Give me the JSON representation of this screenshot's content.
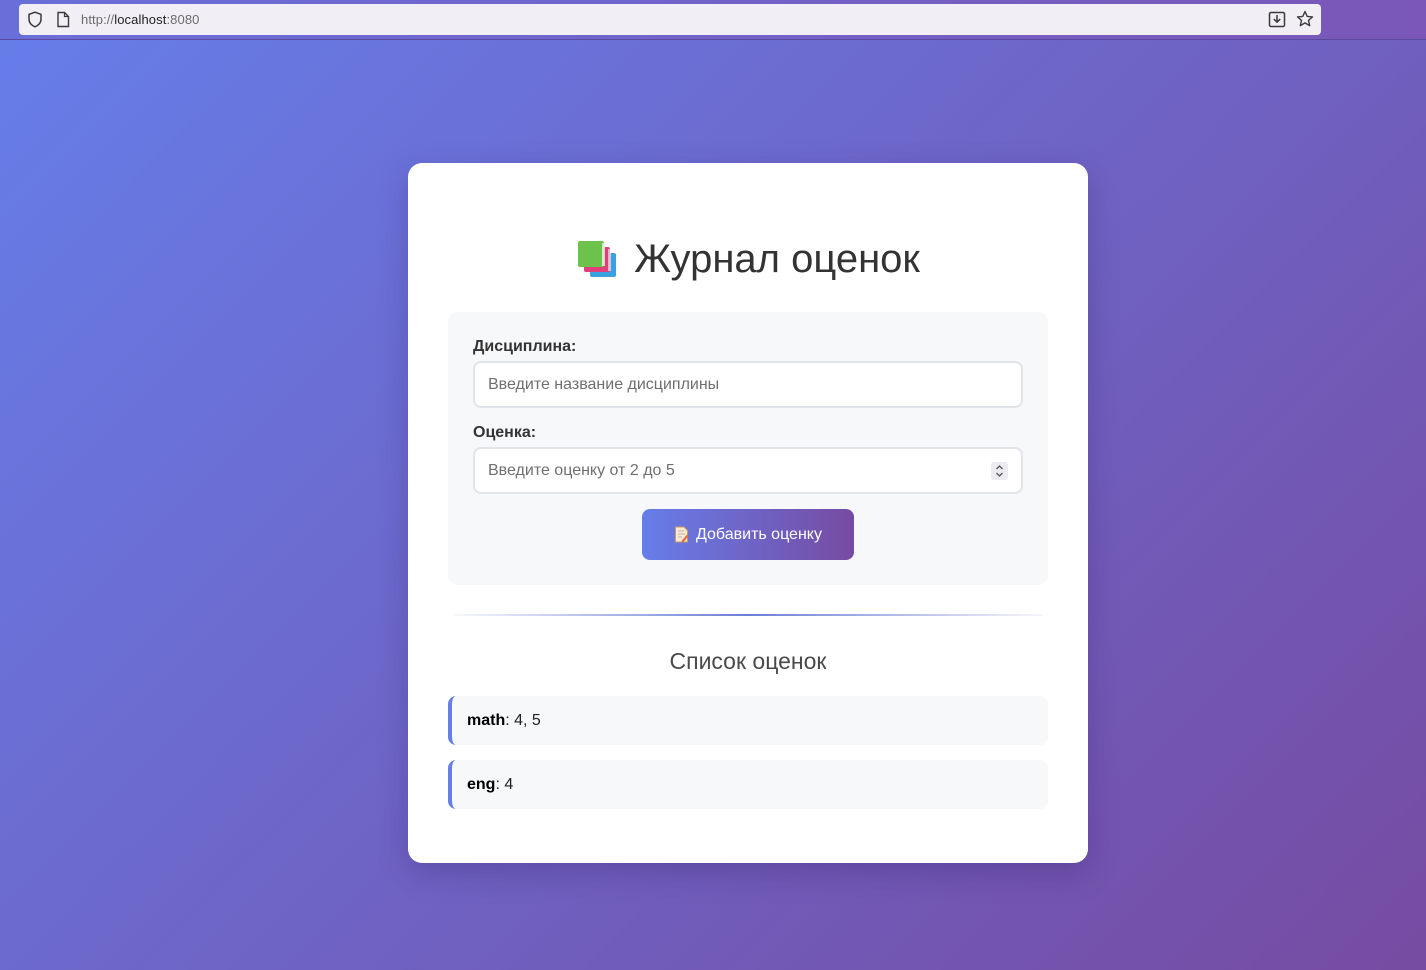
{
  "browser": {
    "url_scheme": "http://",
    "url_host": "localhost",
    "url_port": ":8080",
    "icons": [
      "shield-icon",
      "page-icon",
      "download-icon",
      "star-icon"
    ]
  },
  "page": {
    "title": "Журнал оценок",
    "title_icon": "books-icon"
  },
  "form": {
    "discipline_label": "Дисциплина:",
    "discipline_placeholder": "Введите название дисциплины",
    "discipline_value": "",
    "grade_label": "Оценка:",
    "grade_placeholder": "Введите оценку от 2 до 5",
    "grade_value": "",
    "add_button_label": "Добавить оценку",
    "add_button_icon": "memo-icon"
  },
  "grades": {
    "title": "Список оценок",
    "items": [
      {
        "subject": "math",
        "values": ": 4, 5"
      },
      {
        "subject": "eng",
        "values": ": 4"
      }
    ]
  },
  "colors": {
    "gradient_start": "#667eea",
    "gradient_end": "#764ba2",
    "card_bg": "#ffffff",
    "form_bg": "#f7f8fa",
    "item_accent": "#667eea"
  }
}
